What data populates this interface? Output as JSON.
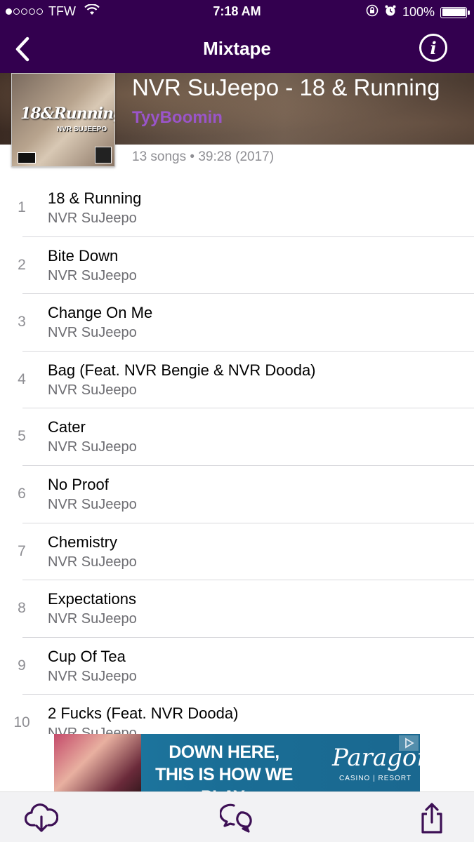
{
  "status_bar": {
    "carrier": "TFW",
    "time": "7:18 AM",
    "battery": "100%"
  },
  "nav": {
    "title": "Mixtape"
  },
  "album": {
    "title": "NVR SuJeepo - 18 & Running",
    "uploader": "TyyBoomin",
    "meta": "13 songs • 39:28 (2017)",
    "art_title": "18&Running",
    "art_subtitle": "NVR SUJEEPO"
  },
  "tracks": [
    {
      "num": "1",
      "title": "18 & Running",
      "artist": "NVR SuJeepo"
    },
    {
      "num": "2",
      "title": "Bite Down",
      "artist": "NVR SuJeepo"
    },
    {
      "num": "3",
      "title": "Change On Me",
      "artist": "NVR SuJeepo"
    },
    {
      "num": "4",
      "title": "Bag (Feat. NVR Bengie & NVR Dooda)",
      "artist": "NVR SuJeepo"
    },
    {
      "num": "5",
      "title": "Cater",
      "artist": "NVR SuJeepo"
    },
    {
      "num": "6",
      "title": "No Proof",
      "artist": "NVR SuJeepo"
    },
    {
      "num": "7",
      "title": "Chemistry",
      "artist": "NVR SuJeepo"
    },
    {
      "num": "8",
      "title": "Expectations",
      "artist": "NVR SuJeepo"
    },
    {
      "num": "9",
      "title": "Cup Of Tea",
      "artist": "NVR SuJeepo"
    },
    {
      "num": "10",
      "title": "2 Fucks (Feat. NVR Dooda)",
      "artist": "NVR SuJeepo"
    }
  ],
  "ad": {
    "line1": "DOWN HERE,",
    "line2": "THIS IS HOW WE PLAY.",
    "brand": "Paragon",
    "brand_sub": "CASINO | RESORT"
  },
  "tab_bar": {
    "download_icon": "cloud-download-icon",
    "comments_icon": "chat-bubbles-icon",
    "share_icon": "share-icon"
  },
  "colors": {
    "header_purple": "#33004f",
    "uploader_purple": "#9a55c9",
    "tab_icon": "#3d1055"
  }
}
